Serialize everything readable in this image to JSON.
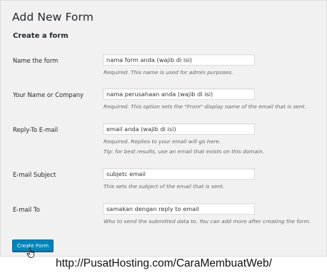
{
  "page": {
    "title": "Add New Form",
    "section_title": "Create a form"
  },
  "fields": [
    {
      "label": "Name the form",
      "value": "nama form anda (wajib di isi)",
      "descriptions": [
        "Required. This name is used for admin purposes."
      ]
    },
    {
      "label": "Your Name or Company",
      "value": "nama perusahaan anda (wajib di isi)",
      "descriptions": [
        "Required. This option sets the \"From\" display name of the email that is sent."
      ]
    },
    {
      "label": "Reply-To E-mail",
      "value": "email anda (wajib di isi)",
      "descriptions": [
        "Required. Replies to your email will go here.",
        "Tip: for best results, use an email that exists on this domain."
      ]
    },
    {
      "label": "E-mail Subject",
      "value": "subjetc email",
      "descriptions": [
        "This sets the subject of the email that is sent."
      ]
    },
    {
      "label": "E-mail To",
      "value": "samakan dengan reply to email",
      "descriptions": [
        "Who to send the submitted data to. You can add more after creating the form."
      ]
    }
  ],
  "actions": {
    "submit_label": "Create Form"
  },
  "watermark": "http://PusatHosting.com/CaraMembuatWeb/",
  "colors": {
    "primary_button": "#0085ba",
    "panel_background": "#f1f1f1"
  },
  "icons": {
    "cursor": "hand-pointer-icon"
  }
}
